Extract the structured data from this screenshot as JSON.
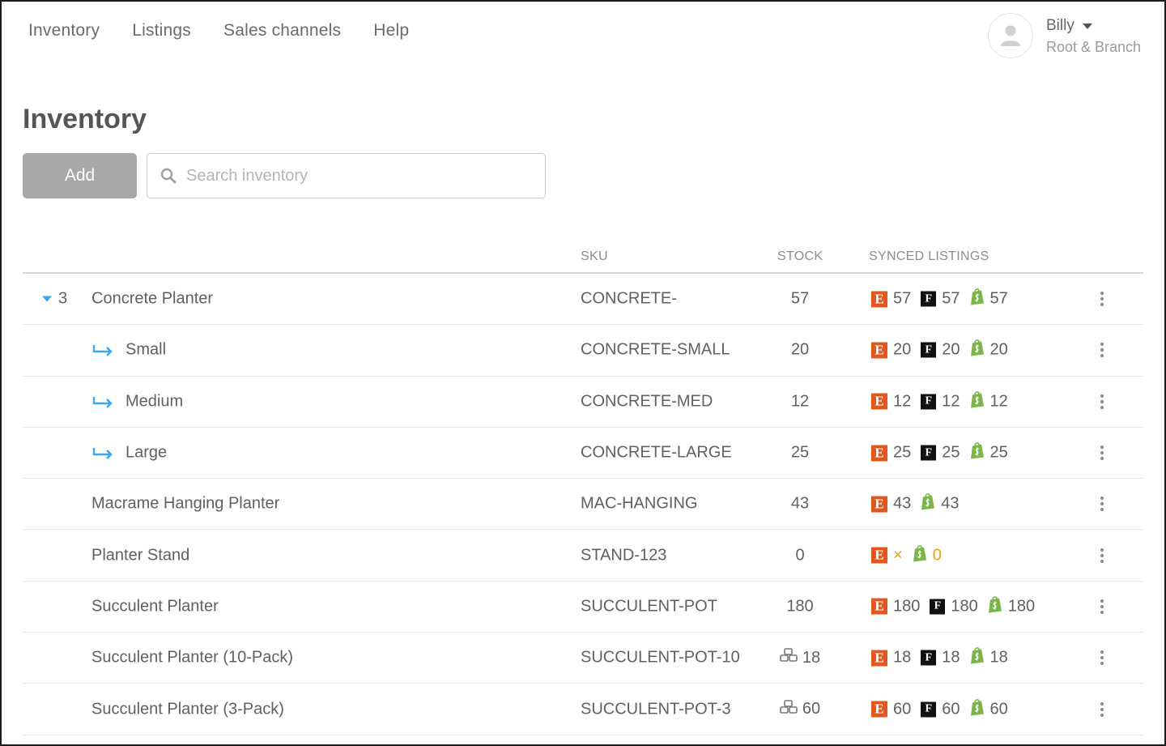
{
  "nav": {
    "items": [
      "Inventory",
      "Listings",
      "Sales channels",
      "Help"
    ]
  },
  "user": {
    "name": "Billy",
    "org": "Root & Branch"
  },
  "page": {
    "title": "Inventory"
  },
  "toolbar": {
    "add_label": "Add",
    "search_placeholder": "Search inventory"
  },
  "table": {
    "headers": {
      "sku": "SKU",
      "stock": "STOCK",
      "synced": "SYNCED LISTINGS"
    },
    "rows": [
      {
        "group_count": "3",
        "name": "Concrete Planter",
        "sku": "CONCRETE-",
        "stock": "57",
        "etsy": "57",
        "faire": "57",
        "shopify": "57"
      },
      {
        "name": "Small",
        "sku": "CONCRETE-SMALL",
        "stock": "20",
        "etsy": "20",
        "faire": "20",
        "shopify": "20"
      },
      {
        "name": "Medium",
        "sku": "CONCRETE-MED",
        "stock": "12",
        "etsy": "12",
        "faire": "12",
        "shopify": "12"
      },
      {
        "name": "Large",
        "sku": "CONCRETE-LARGE",
        "stock": "25",
        "etsy": "25",
        "faire": "25",
        "shopify": "25"
      },
      {
        "name": "Macrame Hanging Planter",
        "sku": "MAC-HANGING",
        "stock": "43",
        "etsy": "43",
        "shopify": "43"
      },
      {
        "name": "Planter Stand",
        "sku": "STAND-123",
        "stock": "0",
        "etsy": "×",
        "shopify": "0"
      },
      {
        "name": "Succulent Planter",
        "sku": "SUCCULENT-POT",
        "stock": "180",
        "etsy": "180",
        "faire": "180",
        "shopify": "180"
      },
      {
        "name": "Succulent Planter (10-Pack)",
        "sku": "SUCCULENT-POT-10",
        "stock": "18",
        "etsy": "18",
        "faire": "18",
        "shopify": "18"
      },
      {
        "name": "Succulent Planter (3-Pack)",
        "sku": "SUCCULENT-POT-3",
        "stock": "60",
        "etsy": "60",
        "faire": "60",
        "shopify": "60"
      }
    ]
  },
  "colors": {
    "etsy": "#e4571c",
    "faire": "#111111",
    "shopify": "#7ab648",
    "accent": "#3aa7f0",
    "warning": "#f0a010"
  },
  "icons": {
    "etsy": "etsy-icon",
    "faire": "faire-icon",
    "shopify": "shopify-icon",
    "bundle": "bundle-icon",
    "variant": "variant-arrow-icon"
  }
}
